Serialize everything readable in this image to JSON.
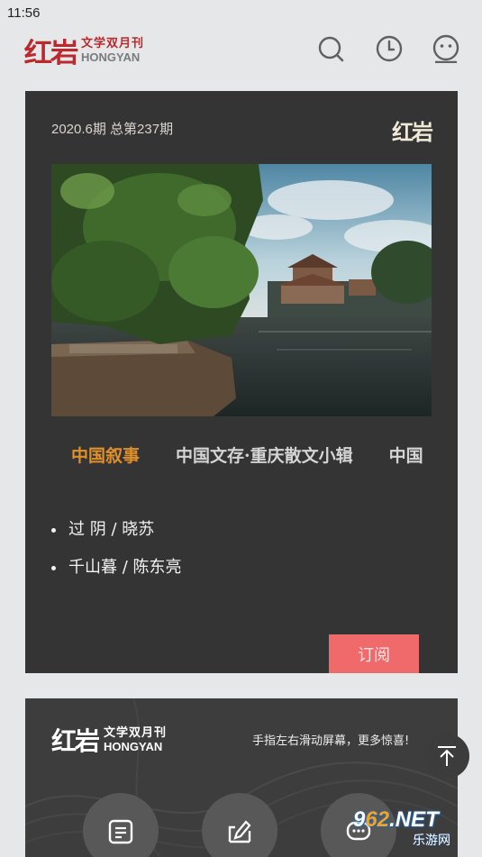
{
  "status_bar": {
    "time": "11:56"
  },
  "header": {
    "logo_mark": "红岩",
    "logo_cn": "文学双月刊",
    "logo_en": "HONGYAN",
    "icons": [
      "search-icon",
      "clock-icon",
      "profile-icon"
    ]
  },
  "issue": {
    "number": "2020.6期 总第237期",
    "logo_mark": "红岩",
    "tabs": [
      "中国叙事",
      "中国文存·重庆散文小辑",
      "中国"
    ],
    "active_tab": 0,
    "articles": [
      "过 阴 / 晓苏",
      "千山暮 / 陈东亮"
    ],
    "subscribe_label": "订阅",
    "colors": {
      "card_bg": "#343434",
      "active_tab": "#e0902a",
      "subscribe_bg": "#f16a6b"
    }
  },
  "promo": {
    "logo_mark": "红岩",
    "logo_cn": "文学双月刊",
    "logo_en": "HONGYAN",
    "hint": "手指左右滑动屏幕，更多惊喜!",
    "buttons": [
      "document-icon",
      "edit-icon",
      "chat-icon"
    ]
  },
  "watermark": {
    "prefix": "9",
    "accent": "62",
    "suffix": ".NET",
    "sub": "乐游网"
  }
}
